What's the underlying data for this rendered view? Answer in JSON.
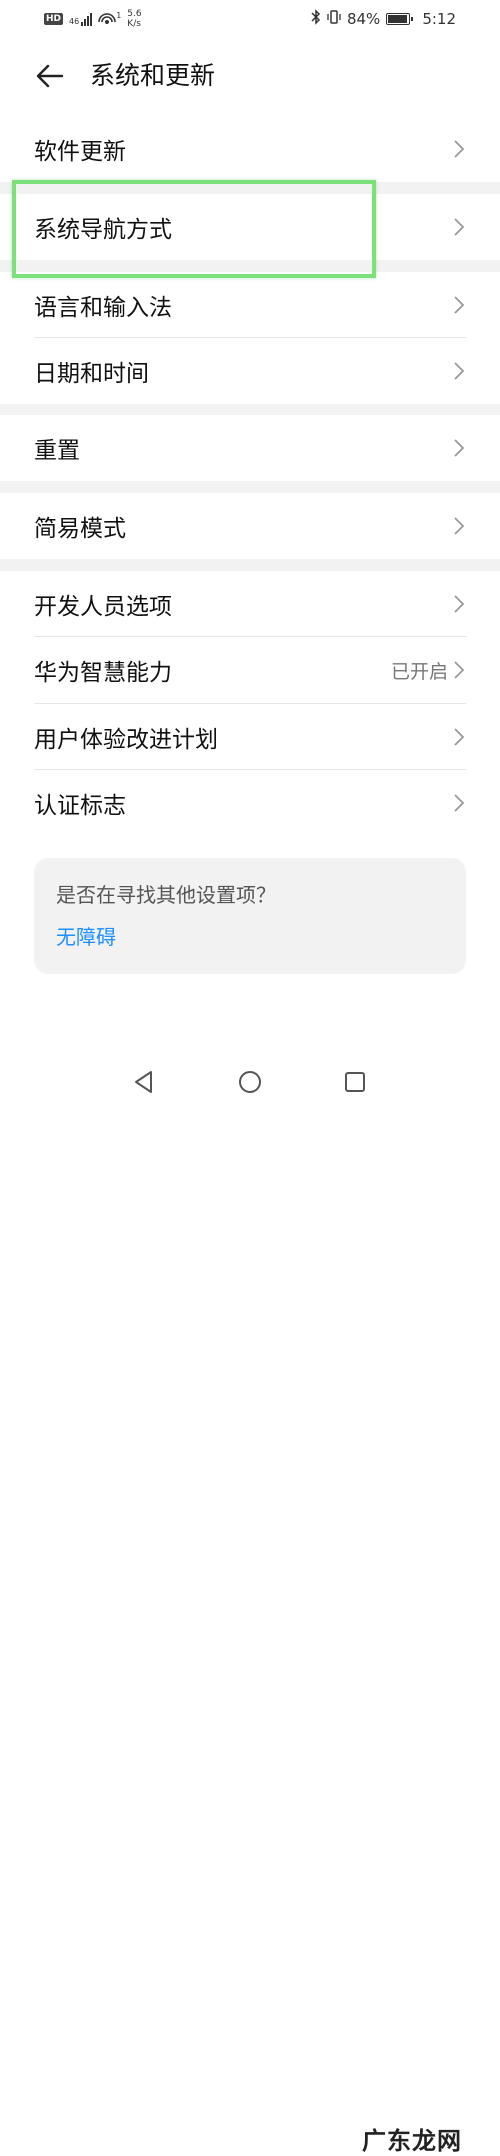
{
  "status_bar": {
    "hd": "HD",
    "signal": "46",
    "net_speed_value": "5.6",
    "net_speed_unit": "K/s",
    "notif_count": "1",
    "battery": "84%",
    "time": "5:12"
  },
  "header": {
    "title": "系统和更新",
    "back_icon": "arrow-left-icon"
  },
  "items": {
    "software_update": "软件更新",
    "navigation": "系统导航方式",
    "language": "语言和输入法",
    "datetime": "日期和时间",
    "reset": "重置",
    "simple_mode": "简易模式",
    "developer": "开发人员选项",
    "huawei_ai": "华为智慧能力",
    "huawei_ai_value": "已开启",
    "ux_plan": "用户体验改进计划",
    "certification": "认证标志"
  },
  "suggestion": {
    "question": "是否在寻找其他设置项？",
    "link": "无障碍"
  },
  "watermark": "广东龙网",
  "colors": {
    "accent": "#1e90ff",
    "highlight": "#7ee07a",
    "section_bg": "#f2f2f2"
  }
}
